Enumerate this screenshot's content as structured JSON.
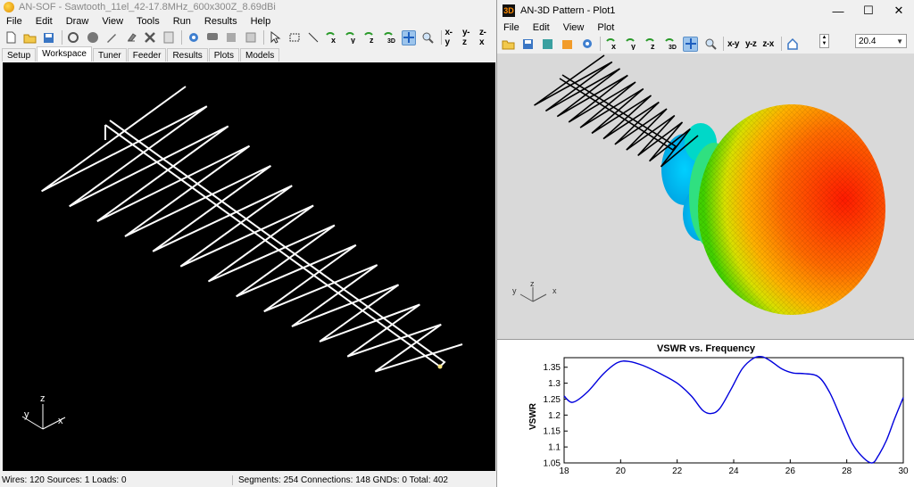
{
  "left_window": {
    "title": "AN-SOF - Sawtooth_11el_42-17.8MHz_600x300Z_8.69dBi",
    "menu": [
      "File",
      "Edit",
      "Draw",
      "View",
      "Tools",
      "Run",
      "Results",
      "Help"
    ],
    "toolbar_axis_labels": [
      "x",
      "y",
      "z",
      "3D"
    ],
    "toolbar_view_labels": [
      "x-y",
      "y-z",
      "z-x"
    ],
    "tabs": [
      "Setup",
      "Workspace",
      "Tuner",
      "Feeder",
      "Results",
      "Plots",
      "Models"
    ],
    "active_tab": "Workspace",
    "axes_labels": {
      "z": "z",
      "y": "y",
      "x": "x"
    },
    "status": {
      "left": "Wires: 120  Sources: 1  Loads: 0",
      "right": "Segments: 254  Connections: 148  GNDs: 0  Total: 402"
    }
  },
  "right_window": {
    "title": "AN-3D Pattern - Plot1",
    "icon_text": "3D",
    "window_controls": [
      "—",
      "☐",
      "✕"
    ],
    "menu": [
      "File",
      "Edit",
      "View",
      "Plot"
    ],
    "toolbar_axis_labels": [
      "x",
      "y",
      "z",
      "3D"
    ],
    "toolbar_view_labels": [
      "x-y",
      "y-z",
      "z-x"
    ],
    "zoom_value": "20.4",
    "axes_labels": {
      "z": "z",
      "y": "y",
      "x": "x"
    }
  },
  "chart_data": {
    "type": "line",
    "title": "VSWR vs. Frequency",
    "xlabel": "",
    "ylabel": "VSWR",
    "xlim": [
      18,
      30
    ],
    "ylim": [
      1.05,
      1.38
    ],
    "x_ticks": [
      "18",
      "20",
      "22",
      "24",
      "26",
      "28",
      "30"
    ],
    "y_ticks": [
      "1.05",
      "1.1",
      "1.15",
      "1.2",
      "1.25",
      "1.3",
      "1.35"
    ],
    "grid": false,
    "series": [
      {
        "color": "#0000dd",
        "x": [
          18.0,
          18.3,
          18.8,
          19.4,
          19.9,
          20.3,
          20.8,
          21.4,
          22.0,
          22.5,
          22.9,
          23.2,
          23.5,
          23.9,
          24.3,
          24.7,
          25.0,
          25.3,
          25.7,
          26.1,
          26.5,
          27.0,
          27.4,
          27.8,
          28.2,
          28.6,
          28.9,
          29.1,
          29.4,
          29.7,
          30.0
        ],
        "y": [
          1.26,
          1.24,
          1.27,
          1.33,
          1.365,
          1.368,
          1.355,
          1.33,
          1.3,
          1.26,
          1.215,
          1.205,
          1.22,
          1.28,
          1.345,
          1.378,
          1.383,
          1.37,
          1.345,
          1.332,
          1.33,
          1.32,
          1.27,
          1.19,
          1.11,
          1.065,
          1.05,
          1.07,
          1.12,
          1.19,
          1.255
        ]
      }
    ]
  }
}
